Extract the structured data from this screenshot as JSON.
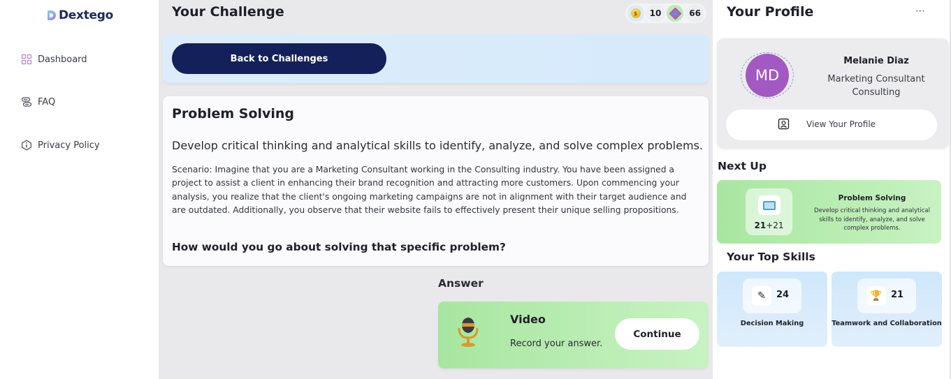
{
  "sidebar": {
    "brand": "Dextego",
    "items": [
      {
        "label": "Dashboard",
        "icon": "grid-icon"
      },
      {
        "label": "FAQ",
        "icon": "faq-icon"
      },
      {
        "label": "Privacy Policy",
        "icon": "info-icon"
      }
    ]
  },
  "header": {
    "title": "Your Challenge",
    "coins": "10",
    "gems": "66"
  },
  "back_button": "Back to Challenges",
  "problem": {
    "title": "Problem Solving",
    "summary": "Develop critical thinking and analytical skills to identify, analyze, and solve complex problems.",
    "scenario": "Scenario: Imagine that you are a Marketing Consultant working in the Consulting industry. You have been assigned a project to assist a client in enhancing their brand recognition and attracting more customers. Upon commencing your analysis, you realize that the client's ongoing marketing campaigns are not in alignment with their target audience and are outdated. Additionally, you observe that their website fails to effectively present their unique selling propositions.",
    "question": "How would you go about solving that specific problem?"
  },
  "answer": {
    "heading": "Answer",
    "type": "Video",
    "subtitle": "Record your answer.",
    "continue_label": "Continue"
  },
  "profile": {
    "heading": "Your Profile",
    "more_label": "⋯",
    "initials": "MD",
    "name": "Melanie Diaz",
    "role": "Marketing Consultant",
    "industry": "Consulting",
    "view_label": "View Your Profile",
    "avatar_color": "#a259c2"
  },
  "next_up": {
    "heading": "Next Up",
    "points": "21",
    "bonus": "+21",
    "title": "Problem Solving",
    "description": "Develop critical thinking and analytical skills to identify, analyze, and solve complex problems."
  },
  "top_skills": {
    "heading": "Your Top Skills",
    "items": [
      {
        "value": "24",
        "name": "Decision Making",
        "icon": "decision-icon"
      },
      {
        "value": "21",
        "name": "Teamwork and Collaboration",
        "icon": "trophy-icon"
      }
    ]
  },
  "colors": {
    "navy": "#14205a",
    "green_card": "#a8e6a0",
    "blue_card": "#d6eafb"
  }
}
